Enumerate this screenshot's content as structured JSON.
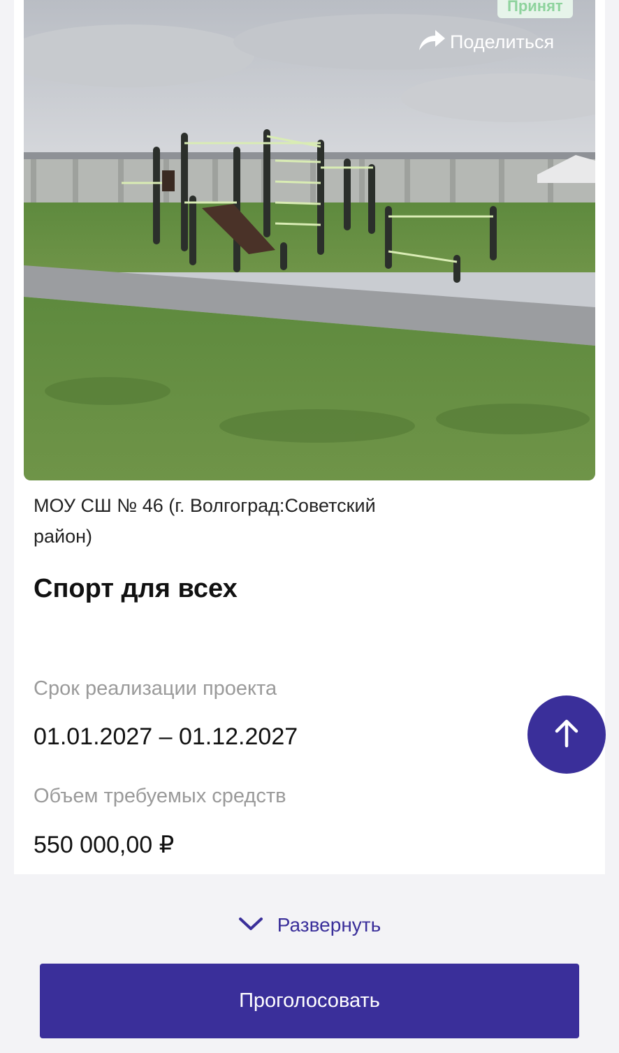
{
  "project": {
    "status": "Принят",
    "share_label": "Поделиться",
    "organization": "МОУ СШ № 46 (г. Волгоград:Советский район)",
    "title": "Спорт для всех",
    "period_label": "Срок реализации проекта",
    "period_value": "01.01.2027 – 01.12.2027",
    "funds_label": "Объем требуемых средств",
    "funds_value": "550 000,00 ₽"
  },
  "actions": {
    "expand_label": "Развернуть",
    "vote_label": "Проголосовать"
  },
  "icons": {
    "share": "share-arrow-icon",
    "scroll_top": "arrow-up-icon",
    "expand": "chevron-down-icon"
  },
  "colors": {
    "accent": "#3a2f9a",
    "badge_bg": "#e6f4ea",
    "badge_text": "#8ed39d"
  }
}
